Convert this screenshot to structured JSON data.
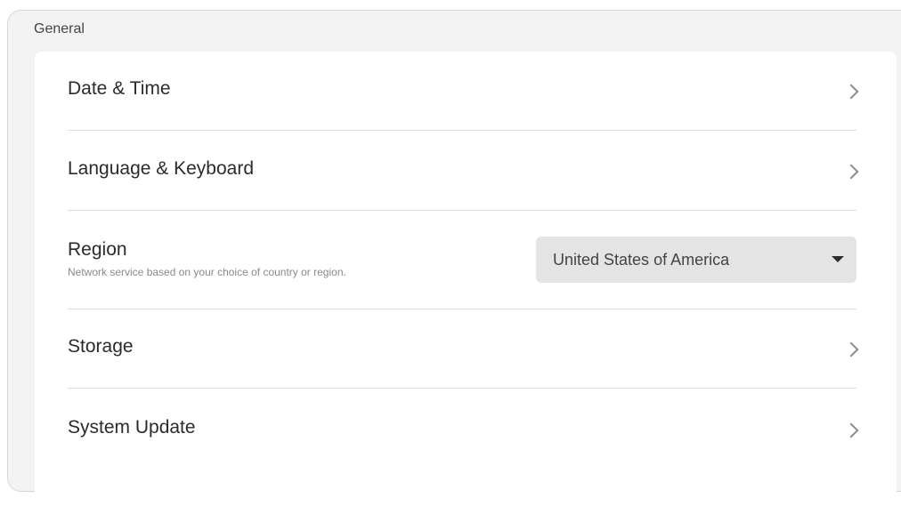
{
  "section": {
    "title": "General"
  },
  "items": [
    {
      "label": "Date & Time"
    },
    {
      "label": "Language & Keyboard"
    },
    {
      "label": "Region",
      "sublabel": "Network service based on your choice of country or region."
    },
    {
      "label": "Storage"
    },
    {
      "label": "System Update"
    }
  ],
  "region_select": {
    "value": "United States of America"
  }
}
